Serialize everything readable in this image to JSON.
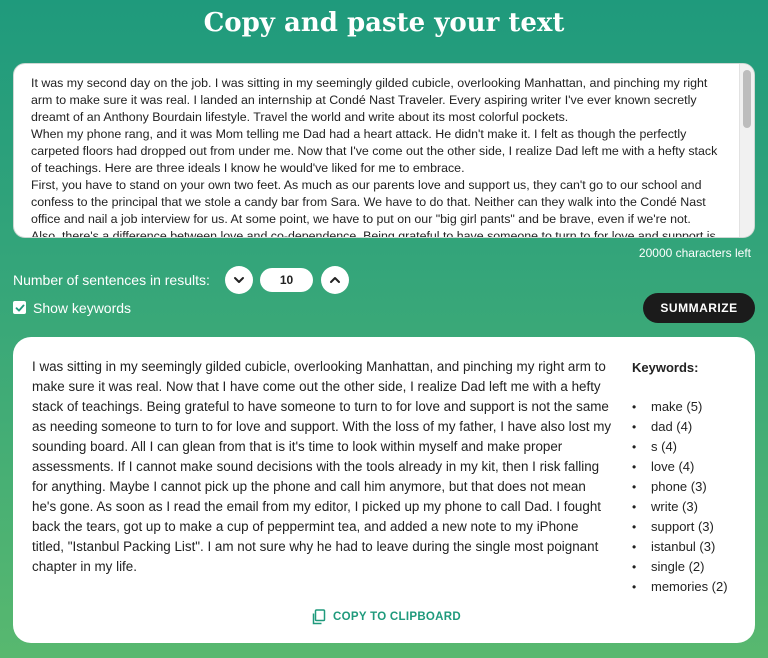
{
  "header": {
    "title": "Copy and paste your text"
  },
  "input": {
    "text": "It was my second day on the job. I was sitting in my seemingly gilded cubicle, overlooking Manhattan, and pinching my right arm to make sure it was real. I landed an internship at Condé Nast Traveler. Every aspiring writer I've ever known secretly dreamt of an Anthony Bourdain lifestyle. Travel the world and write about its most colorful pockets.\nWhen my phone rang, and it was Mom telling me Dad had a heart attack. He didn't make it. I felt as though the perfectly carpeted floors had dropped out from under me. Now that I've come out the other side, I realize Dad left me with a hefty stack of teachings. Here are three ideals I know he would've liked for me to embrace.\nFirst, you have to stand on your own two feet. As much as our parents love and support us, they can't go to our school and confess to the principal that we stole a candy bar from Sara. We have to do that. Neither can they walk into the Condé Nast office and nail a job interview for us. At some point, we have to put on our \"big girl pants\" and be brave, even if we're not.\nAlso, there's a difference between love and co-dependence. Being grateful to have someone to turn to for love and support is",
    "chars_left": "20000 characters left"
  },
  "controls": {
    "sentences_label": "Number of sentences in results:",
    "sentences_value": "10",
    "show_keywords_label": "Show keywords",
    "show_keywords_checked": true,
    "summarize_label": "SUMMARIZE"
  },
  "result": {
    "summary": "I was sitting in my seemingly gilded cubicle, overlooking Manhattan, and pinching my right arm to make sure it was real. Now that I have come out the other side, I realize Dad left me with a hefty stack of teachings. Being grateful to have someone to turn to for love and support is not the same as needing someone to turn to for love and support. With the loss of my father, I have also lost my sounding board. All I can glean from that is it's time to look within myself and make proper assessments. If I cannot make sound decisions with the tools already in my kit, then I risk falling for anything. Maybe I cannot pick up the phone and call him anymore, but that does not mean he's gone. As soon as I read the email from my editor, I picked up my phone to call Dad. I fought back the tears, got up to make a cup of peppermint tea, and added a new note to my iPhone titled, \"Istanbul Packing List\". I am not sure why he had to leave during the single most poignant chapter in my life.",
    "keywords_title": "Keywords:",
    "keywords": [
      "make (5)",
      "dad (4)",
      "s (4)",
      "love (4)",
      "phone (3)",
      "write (3)",
      "support (3)",
      "istanbul (3)",
      "single (2)",
      "memories (2)"
    ],
    "copy_label": "COPY TO CLIPBOARD"
  },
  "icons": {
    "decrease": "chevron-down-icon",
    "increase": "chevron-up-icon",
    "checkbox": "check-icon",
    "copy": "clipboard-icon"
  },
  "colors": {
    "accent": "#1f9a7c",
    "button_dark": "#1b1b1b"
  }
}
